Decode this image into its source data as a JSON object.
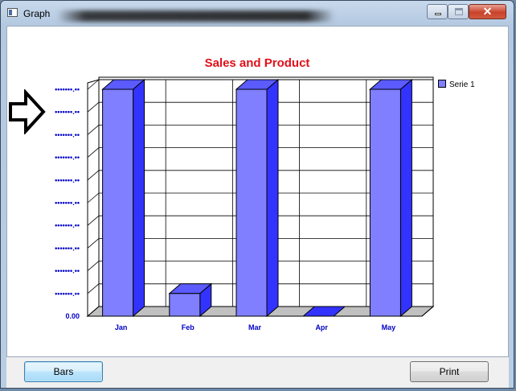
{
  "window": {
    "title": "Graph",
    "close_glyph": "✕"
  },
  "buttons": {
    "bars": "Bars",
    "print": "Print"
  },
  "colors": {
    "bar_front": "#7f7fff",
    "bar_top": "#5b5bff",
    "bar_side": "#3333ff",
    "title": "#e0101a",
    "axis_labels": "#0000c8"
  },
  "chart_data": {
    "type": "bar",
    "title": "Sales and Product",
    "categories": [
      "Jan",
      "Feb",
      "Mar",
      "Apr",
      "May"
    ],
    "series": [
      {
        "name": "Serie 1",
        "values": [
          100,
          10,
          100,
          0,
          100
        ]
      }
    ],
    "ylim": [
      0,
      100
    ],
    "y_tick_labels": [
      "0.00",
      "•••••••.••",
      "•••••••.••",
      "•••••••.••",
      "•••••••.••",
      "•••••••.••",
      "•••••••.••",
      "•••••••.••",
      "•••••••.••",
      "•••••••.••",
      "•••••••.••"
    ],
    "grid": true,
    "legend": "top-right",
    "style": "3d"
  }
}
